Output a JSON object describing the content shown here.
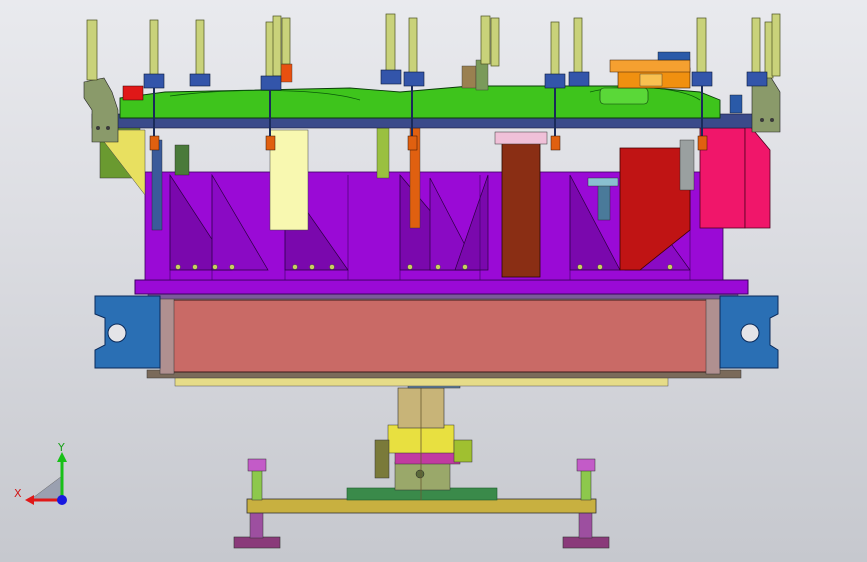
{
  "viewport": {
    "background_top": "#e9eaee",
    "background_bottom": "#c6c8ce"
  },
  "model": {
    "colors": {
      "frame_purple": "#9a0ad6",
      "frame_purple_dark": "#6d0896",
      "drum_red": "#c96a66",
      "end_block_blue": "#2a6fb4",
      "top_rail_green": "#3ec41c",
      "pin_olive": "#c9d27a",
      "clamp_blue": "#3355aa",
      "accent_red": "#d01818",
      "accent_pink": "#f0166a",
      "accent_orange": "#e06010",
      "brown_block": "#8a2e14",
      "shaft_gold": "#c8b478",
      "base_plate": "#c8b040",
      "foot_plum": "#8a3a7a"
    }
  },
  "triad": {
    "x_label": "X",
    "y_label": "Y",
    "x_color": "#e01818",
    "y_color": "#18c018",
    "z_color": "#1818e0",
    "icon": "coordinate-triad-icon"
  }
}
